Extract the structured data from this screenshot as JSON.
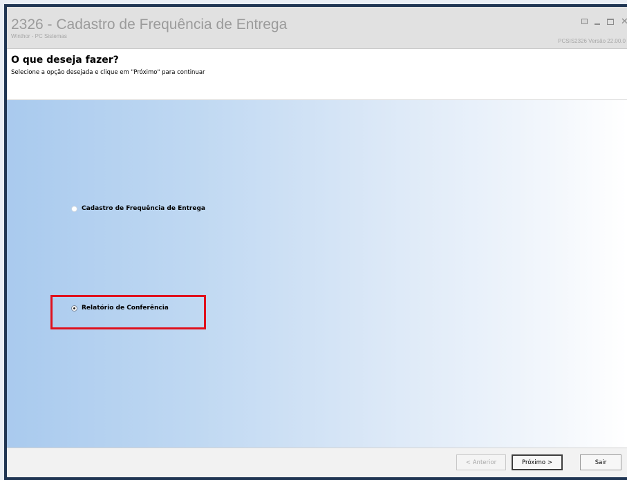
{
  "window": {
    "title": "2326 - Cadastro de Frequência de Entrega",
    "subtitle": "Winthor - PC Sistemas",
    "version": "PCSIS2326   Versão 22.00.0"
  },
  "header": {
    "title": "O que deseja fazer?",
    "subtitle": "Selecione a opção desejada e clique em \"Próximo\" para continuar"
  },
  "options": [
    {
      "label": "Cadastro de Frequência de Entrega",
      "selected": false
    },
    {
      "label": "Relatório de Conferência",
      "selected": true
    }
  ],
  "footer": {
    "prev_label": "< Anterior",
    "next_label": "Próximo >",
    "exit_label": "Sair"
  },
  "colors": {
    "title_border": "#1f3553",
    "highlight": "#e0101c",
    "content_gradient_start": "#a9caee"
  }
}
